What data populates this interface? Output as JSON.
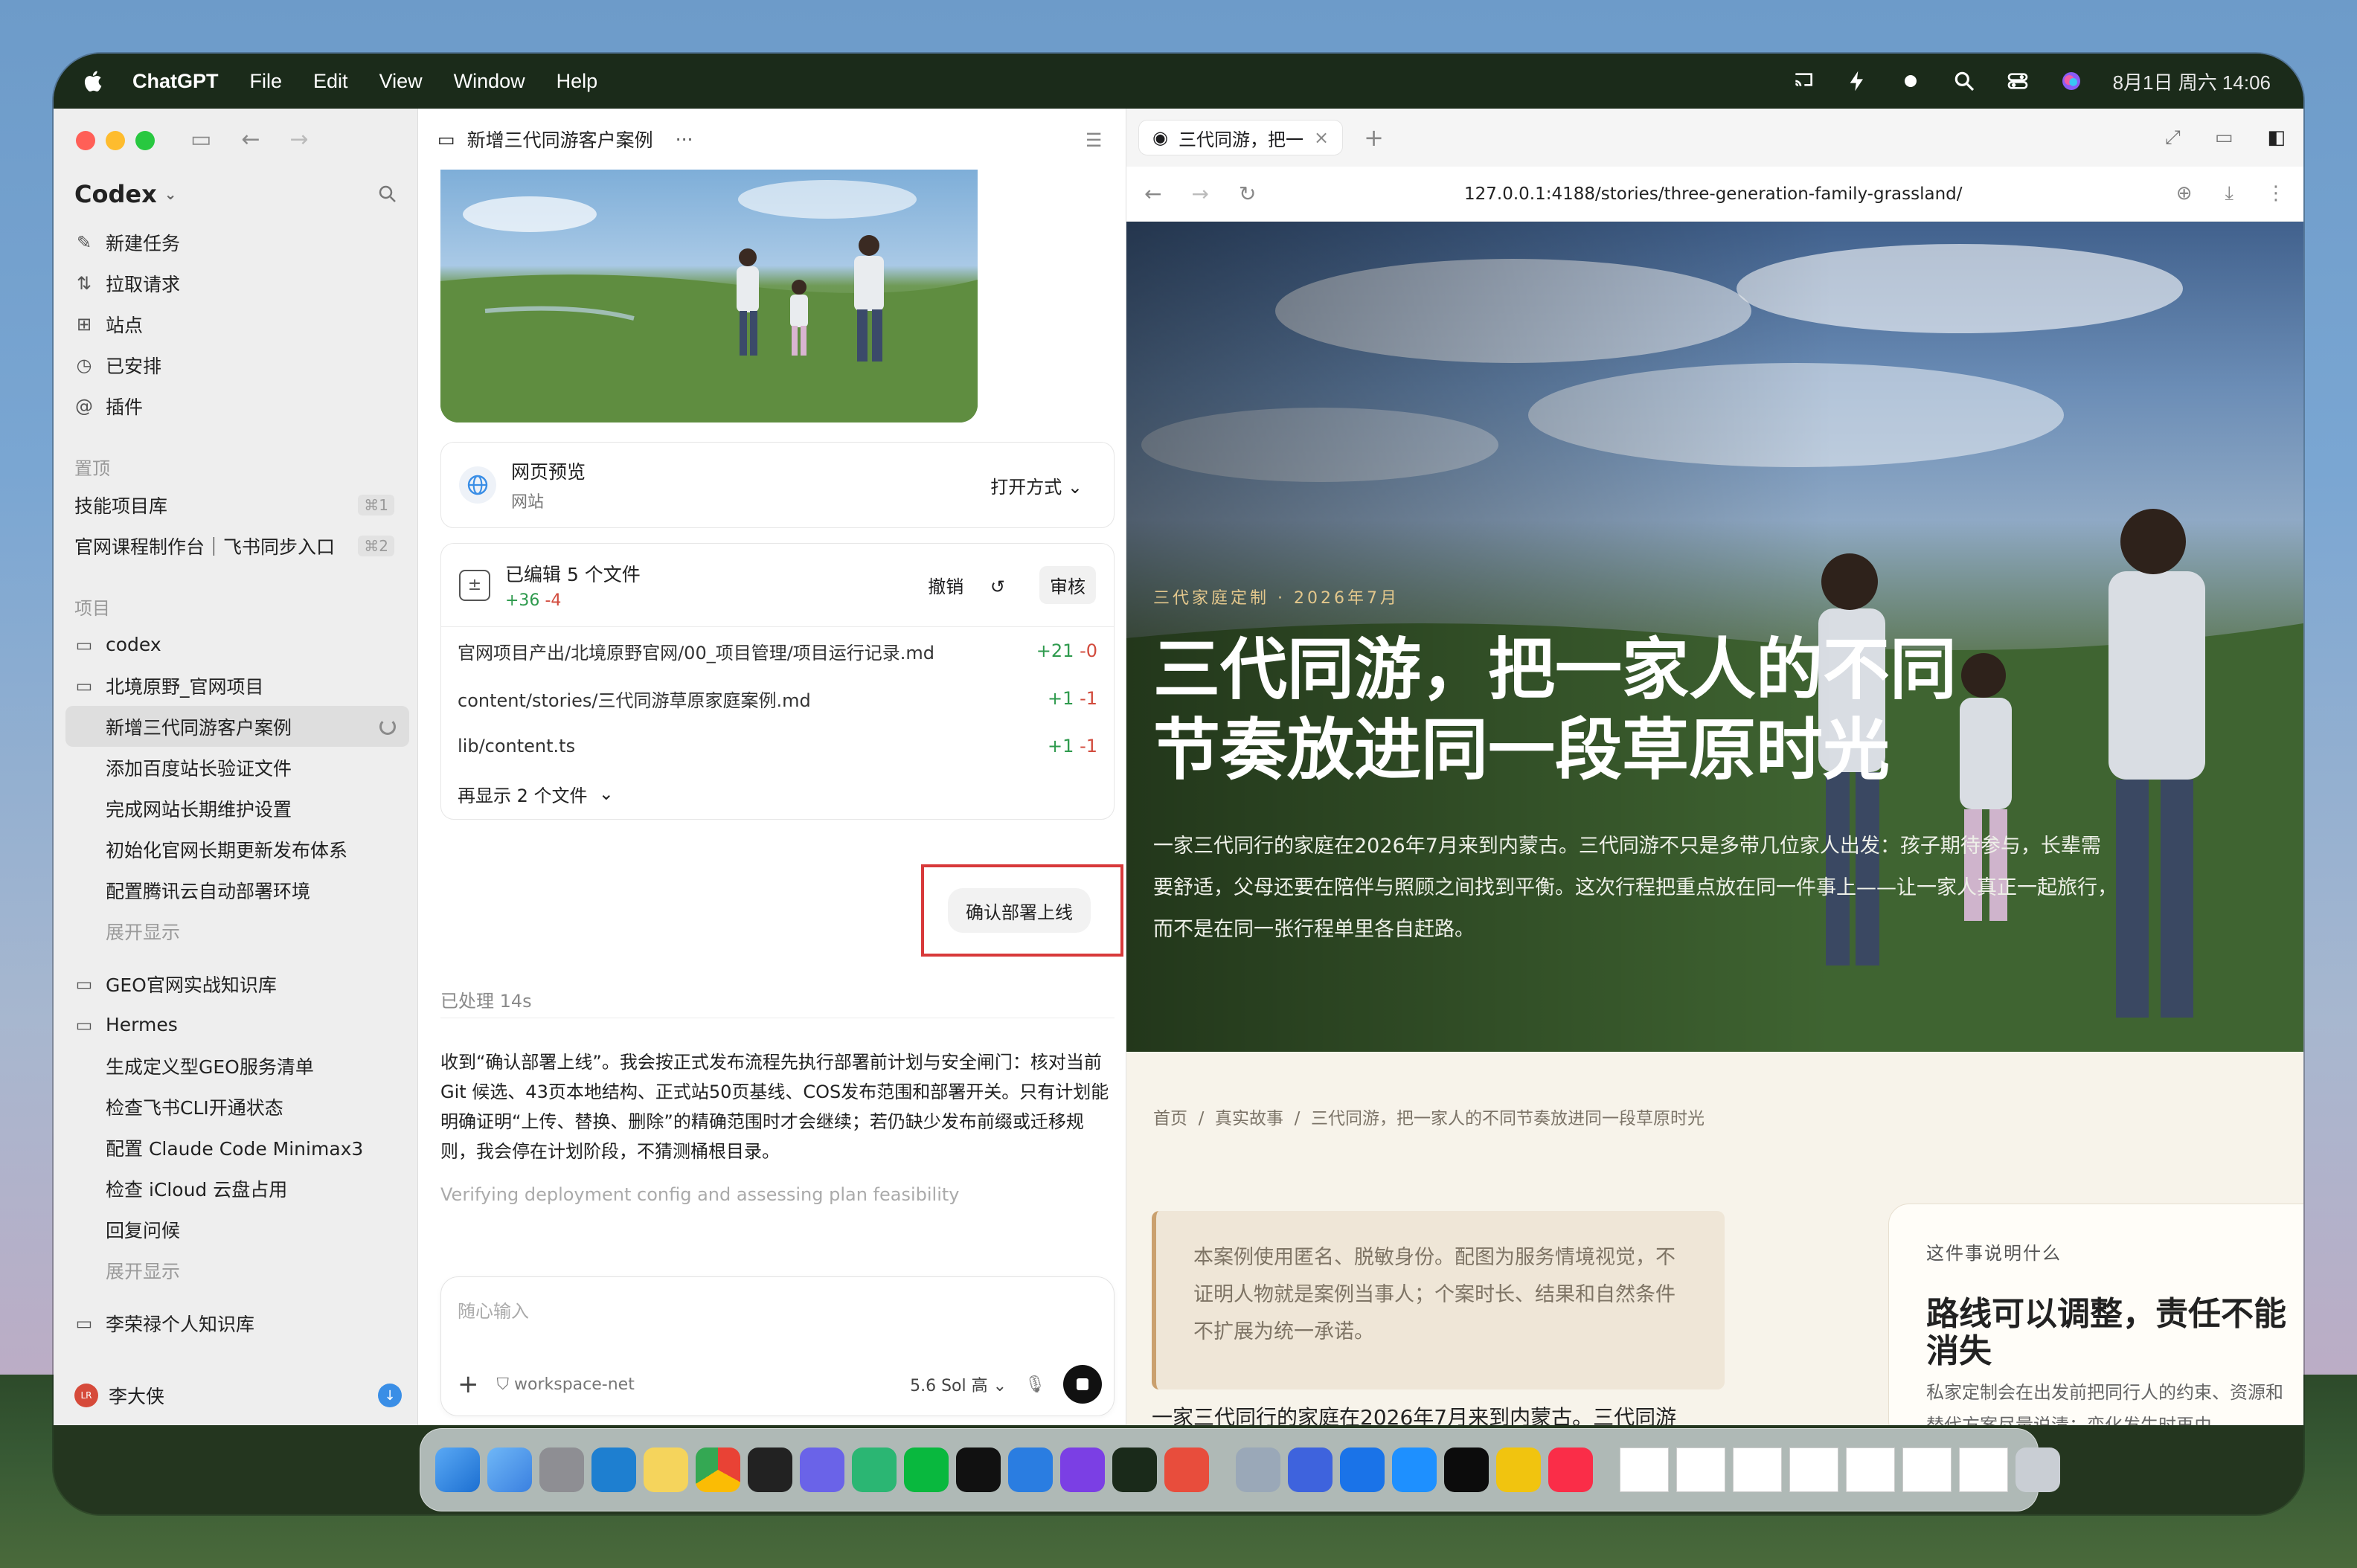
{
  "menubar": {
    "app_name": "ChatGPT",
    "menus": [
      "File",
      "Edit",
      "View",
      "Window",
      "Help"
    ],
    "clock": "8月1日 周六  14:06"
  },
  "sidebar": {
    "brand": "Codex",
    "nav": [
      {
        "label": "新建任务",
        "icon": "edit-icon"
      },
      {
        "label": "拉取请求",
        "icon": "pull-request-icon"
      },
      {
        "label": "站点",
        "icon": "grid-icon"
      },
      {
        "label": "已安排",
        "icon": "clock-icon"
      },
      {
        "label": "插件",
        "icon": "at-icon"
      }
    ],
    "pinned_section": "置顶",
    "pinned": [
      {
        "label": "技能项目库",
        "shortcut": "⌘1"
      },
      {
        "label": "官网课程制作台｜飞书同步入口",
        "shortcut": "⌘2"
      }
    ],
    "projects_section": "项目",
    "projects": {
      "codex": "codex",
      "beijing": "北境原野_官网项目",
      "beijing_items": [
        "新增三代同游客户案例",
        "添加百度站长验证文件",
        "完成网站长期维护设置",
        "初始化官网长期更新发布体系",
        "配置腾讯云自动部署环境"
      ],
      "show_more_1": "展开显示",
      "geo": "GEO官网实战知识库",
      "hermes": "Hermes",
      "hermes_items": [
        "生成定义型GEO服务清单",
        "检查飞书CLI开通状态",
        "配置 Claude Code Minimax3",
        "检查 iCloud 云盘占用",
        "回复问候"
      ],
      "show_more_2": "展开显示",
      "personal": "李荣禄个人知识库"
    },
    "user": {
      "name": "李大侠",
      "initials": "LR"
    }
  },
  "chat": {
    "title": "新增三代同游客户案例",
    "more": "···",
    "preview_card": {
      "title": "网页预览",
      "subtitle": "网站",
      "open_with": "打开方式"
    },
    "files_card": {
      "title": "已编辑 5 个文件",
      "added": "+36",
      "removed": "-4",
      "undo": "撤销",
      "review": "审核",
      "files": [
        {
          "path": "官网项目产出/北境原野官网/00_项目管理/项目运行记录.md",
          "added": "+21",
          "removed": "-0"
        },
        {
          "path": "content/stories/三代同游草原家庭案例.md",
          "added": "+1",
          "removed": "-1"
        },
        {
          "path": "lib/content.ts",
          "added": "+1",
          "removed": "-1"
        }
      ],
      "show_more": "再显示 2 个文件"
    },
    "confirm_label": "确认部署上线",
    "processed": "已处理 14s",
    "message": "收到“确认部署上线”。我会按正式发布流程先执行部署前计划与安全闸门：核对当前 Git 候选、43页本地结构、正式站50页基线、COS发布范围和部署开关。只有计划能明确证明“上传、替换、删除”的精确范围时才会继续；若仍缺少发布前缀或迁移规则，我会停在计划阶段，不猜测桶根目录。",
    "thinking": "Verifying deployment config and assessing plan feasibility",
    "composer": {
      "placeholder": "随心输入",
      "workspace": "workspace-net",
      "model": "5.6 Sol 高"
    }
  },
  "browser": {
    "tab_title": "三代同游，把一",
    "url": "127.0.0.1:4188/stories/three-generation-family-grassland/",
    "page": {
      "kicker": "三代家庭定制 · 2026年7月",
      "headline": "三代同游，把一家人的不同节奏放进同一段草原时光",
      "lede": "一家三代同行的家庭在2026年7月来到内蒙古。三代同游不只是多带几位家人出发：孩子期待参与，长辈需要舒适，父母还要在陪伴与照顾之间找到平衡。这次行程把重点放在同一件事上——让一家人真正一起旅行，而不是在同一张行程单里各自赶路。",
      "breadcrumbs": [
        "首页",
        "真实故事",
        "三代同游，把一家人的不同节奏放进同一段草原时光"
      ],
      "disclaimer": "本案例使用匿名、脱敏身份。配图为服务情境视觉，不证明人物就是案例当事人；个案时长、结果和自然条件不扩展为统一承诺。",
      "aside_label": "这件事说明什么",
      "aside_title": "路线可以调整，责任不能消失",
      "aside_body": "私家定制会在出发前把同行人的约束、资源和替代方案尽量说清；变化发生时再由",
      "body_start": "一家三代同行的家庭在2026年7月来到内蒙古。三代同游"
    }
  },
  "colors": {
    "accent_red": "#d8393a",
    "diff_green": "#2e9a4d",
    "diff_red": "#d24b3d",
    "kicker_gold": "#e3c78c"
  }
}
